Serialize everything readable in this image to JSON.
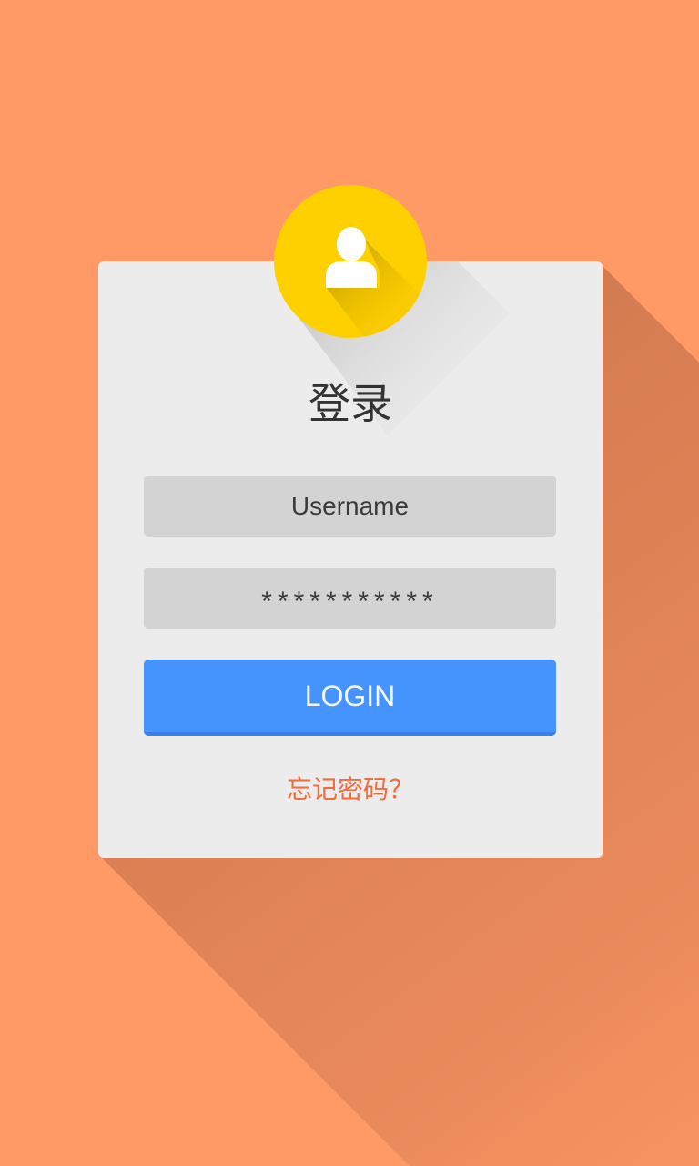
{
  "login_form": {
    "title": "登录",
    "username_placeholder": "Username",
    "password_masked": "***********",
    "login_button": "LOGIN",
    "forgot_password": "忘记密码？"
  },
  "icons": {
    "avatar": "user-icon"
  },
  "colors": {
    "background": "#FF9966",
    "card": "#ECECEC",
    "avatar_circle": "#FFD000",
    "input_fill": "#D3D3D3",
    "button": "#4593FC",
    "link": "#F26B3A"
  }
}
